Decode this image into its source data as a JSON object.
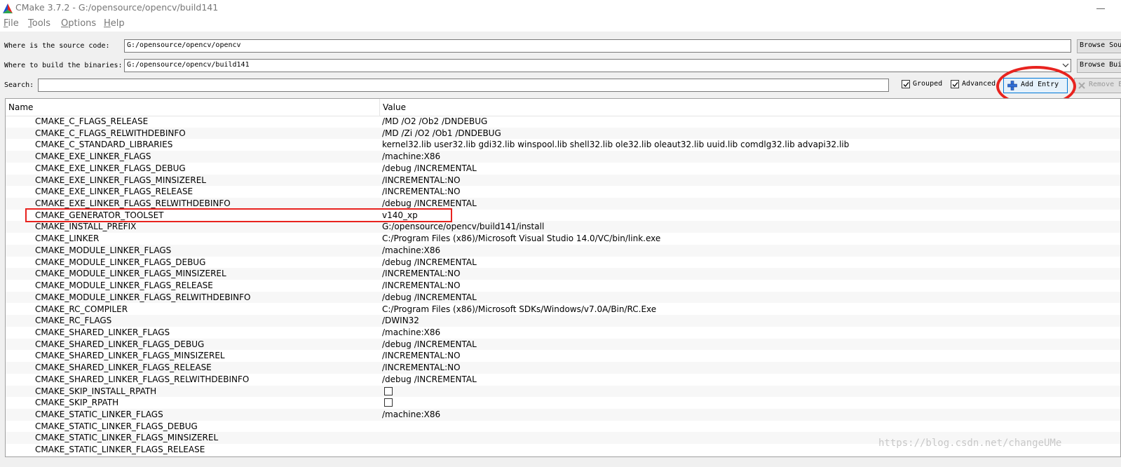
{
  "window": {
    "title": "CMake 3.7.2 - G:/opensource/opencv/build141"
  },
  "menu": [
    "File",
    "Tools",
    "Options",
    "Help"
  ],
  "source": {
    "label": "Where is the source code:",
    "value": "G:/opensource/opencv/opencv",
    "browse_label": "Browse Source..."
  },
  "build": {
    "label": "Where to build the binaries:",
    "value": "G:/opensource/opencv/build141",
    "browse_label": "Browse Build..."
  },
  "search": {
    "label": "Search:",
    "value": ""
  },
  "options": {
    "grouped_label": "Grouped",
    "grouped_checked": true,
    "advanced_label": "Advanced",
    "advanced_checked": true
  },
  "buttons": {
    "add_entry": "Add Entry",
    "remove_entry": "Remove Entry"
  },
  "table": {
    "headers": {
      "name": "Name",
      "value": "Value"
    },
    "rows": [
      {
        "name": "CMAKE_C_FLAGS_RELEASE",
        "value": "/MD /O2 /Ob2 /DNDEBUG"
      },
      {
        "name": "CMAKE_C_FLAGS_RELWITHDEBINFO",
        "value": "/MD /Zi /O2 /Ob1 /DNDEBUG"
      },
      {
        "name": "CMAKE_C_STANDARD_LIBRARIES",
        "value": "kernel32.lib user32.lib gdi32.lib winspool.lib shell32.lib ole32.lib oleaut32.lib uuid.lib comdlg32.lib advapi32.lib"
      },
      {
        "name": "CMAKE_EXE_LINKER_FLAGS",
        "value": "/machine:X86"
      },
      {
        "name": "CMAKE_EXE_LINKER_FLAGS_DEBUG",
        "value": "/debug /INCREMENTAL"
      },
      {
        "name": "CMAKE_EXE_LINKER_FLAGS_MINSIZEREL",
        "value": "/INCREMENTAL:NO"
      },
      {
        "name": "CMAKE_EXE_LINKER_FLAGS_RELEASE",
        "value": "/INCREMENTAL:NO"
      },
      {
        "name": "CMAKE_EXE_LINKER_FLAGS_RELWITHDEBINFO",
        "value": "/debug /INCREMENTAL"
      },
      {
        "name": "CMAKE_GENERATOR_TOOLSET",
        "value": "v140_xp"
      },
      {
        "name": "CMAKE_INSTALL_PREFIX",
        "value": "G:/opensource/opencv/build141/install"
      },
      {
        "name": "CMAKE_LINKER",
        "value": "C:/Program Files (x86)/Microsoft Visual Studio 14.0/VC/bin/link.exe"
      },
      {
        "name": "CMAKE_MODULE_LINKER_FLAGS",
        "value": "/machine:X86"
      },
      {
        "name": "CMAKE_MODULE_LINKER_FLAGS_DEBUG",
        "value": "/debug /INCREMENTAL"
      },
      {
        "name": "CMAKE_MODULE_LINKER_FLAGS_MINSIZEREL",
        "value": "/INCREMENTAL:NO"
      },
      {
        "name": "CMAKE_MODULE_LINKER_FLAGS_RELEASE",
        "value": "/INCREMENTAL:NO"
      },
      {
        "name": "CMAKE_MODULE_LINKER_FLAGS_RELWITHDEBINFO",
        "value": "/debug /INCREMENTAL"
      },
      {
        "name": "CMAKE_RC_COMPILER",
        "value": "C:/Program Files (x86)/Microsoft SDKs/Windows/v7.0A/Bin/RC.Exe"
      },
      {
        "name": "CMAKE_RC_FLAGS",
        "value": "/DWIN32"
      },
      {
        "name": "CMAKE_SHARED_LINKER_FLAGS",
        "value": "/machine:X86"
      },
      {
        "name": "CMAKE_SHARED_LINKER_FLAGS_DEBUG",
        "value": "/debug /INCREMENTAL"
      },
      {
        "name": "CMAKE_SHARED_LINKER_FLAGS_MINSIZEREL",
        "value": "/INCREMENTAL:NO"
      },
      {
        "name": "CMAKE_SHARED_LINKER_FLAGS_RELEASE",
        "value": "/INCREMENTAL:NO"
      },
      {
        "name": "CMAKE_SHARED_LINKER_FLAGS_RELWITHDEBINFO",
        "value": "/debug /INCREMENTAL"
      },
      {
        "name": "CMAKE_SKIP_INSTALL_RPATH",
        "value": "",
        "checkbox": true
      },
      {
        "name": "CMAKE_SKIP_RPATH",
        "value": "",
        "checkbox": true
      },
      {
        "name": "CMAKE_STATIC_LINKER_FLAGS",
        "value": "/machine:X86"
      },
      {
        "name": "CMAKE_STATIC_LINKER_FLAGS_DEBUG",
        "value": ""
      },
      {
        "name": "CMAKE_STATIC_LINKER_FLAGS_MINSIZEREL",
        "value": ""
      },
      {
        "name": "CMAKE_STATIC_LINKER_FLAGS_RELEASE",
        "value": ""
      }
    ]
  },
  "watermark": "https://blog.csdn.net/changeUMe",
  "colors": {
    "annotation_red": "#e8231f",
    "accent_blue": "#0078d7"
  }
}
